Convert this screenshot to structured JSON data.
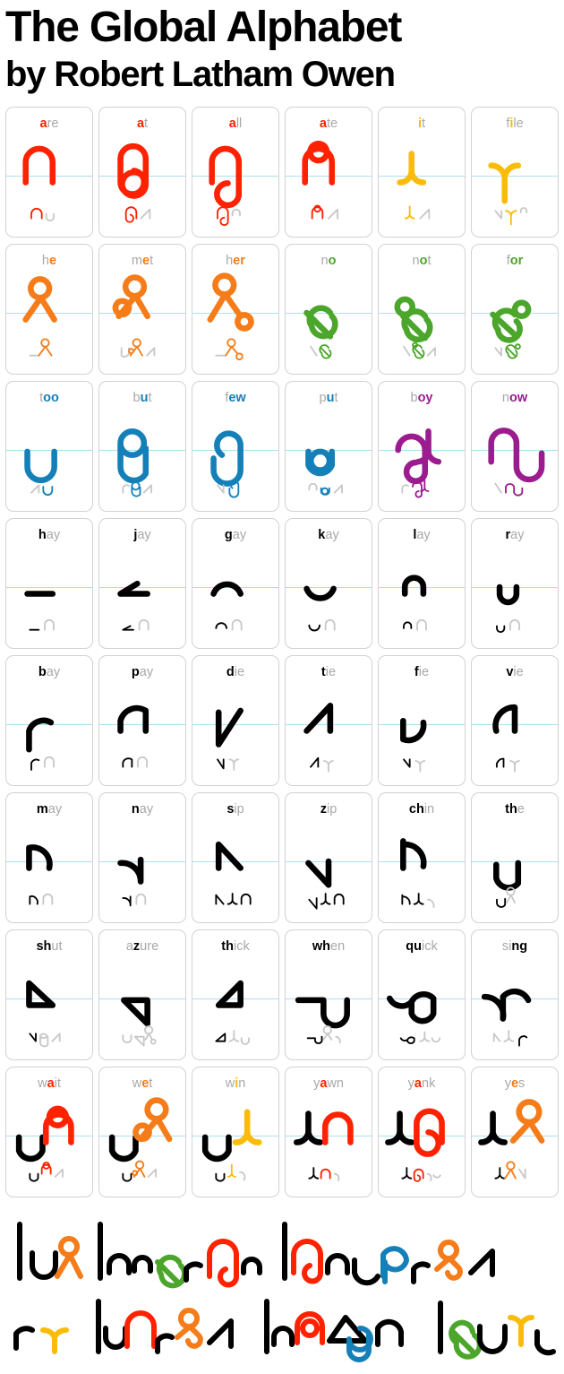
{
  "title": {
    "line1": "The Global Alphabet",
    "line2": "by Robert Latham Owen"
  },
  "colors": {
    "red": "#FF2200",
    "orange": "#F57C18",
    "amber": "#FABB0A",
    "green": "#4CA62B",
    "blue": "#1580B8",
    "purple": "#9B1C8E",
    "black": "#000000",
    "gray": "#a8a8a8",
    "light_gray": "#c8c8c8",
    "baseline": "#addff0",
    "card_border": "#d2d2d2"
  },
  "grid": {
    "columns": 6,
    "rows": 8,
    "cards": [
      {
        "word": "are",
        "highlight": "a",
        "color": "red",
        "big": "are",
        "small": "are"
      },
      {
        "word": "at",
        "highlight": "a",
        "color": "red",
        "big": "at",
        "small": "at"
      },
      {
        "word": "all",
        "highlight": "a",
        "color": "red",
        "big": "all",
        "small": "all"
      },
      {
        "word": "ate",
        "highlight": "a",
        "color": "red",
        "big": "ate",
        "small": "ate"
      },
      {
        "word": "it",
        "highlight": "i",
        "color": "amber",
        "big": "it",
        "small": "it"
      },
      {
        "word": "file",
        "highlight": "i",
        "color": "amber",
        "big": "file",
        "small": "file"
      },
      {
        "word": "he",
        "highlight": "e",
        "color": "orange",
        "big": "he",
        "small": "he"
      },
      {
        "word": "met",
        "highlight": "e",
        "color": "orange",
        "big": "met",
        "small": "met"
      },
      {
        "word": "her",
        "highlight": "er",
        "color": "orange",
        "big": "her",
        "small": "her"
      },
      {
        "word": "no",
        "highlight": "o",
        "color": "green",
        "big": "no",
        "small": "no"
      },
      {
        "word": "not",
        "highlight": "o",
        "color": "green",
        "big": "not",
        "small": "not"
      },
      {
        "word": "for",
        "highlight": "or",
        "color": "green",
        "big": "for",
        "small": "for"
      },
      {
        "word": "too",
        "highlight": "oo",
        "color": "blue",
        "big": "too",
        "small": "too"
      },
      {
        "word": "but",
        "highlight": "u",
        "color": "blue",
        "big": "but",
        "small": "but"
      },
      {
        "word": "few",
        "highlight": "ew",
        "color": "blue",
        "big": "few",
        "small": "few"
      },
      {
        "word": "put",
        "highlight": "u",
        "color": "blue",
        "big": "put",
        "small": "put"
      },
      {
        "word": "boy",
        "highlight": "oy",
        "color": "purple",
        "big": "boy",
        "small": "boy"
      },
      {
        "word": "now",
        "highlight": "ow",
        "color": "purple",
        "big": "now",
        "small": "now"
      },
      {
        "word": "hay",
        "highlight": "h",
        "color": "black",
        "big": "hay",
        "small": "hay"
      },
      {
        "word": "jay",
        "highlight": "j",
        "color": "black",
        "big": "jay",
        "small": "jay"
      },
      {
        "word": "gay",
        "highlight": "g",
        "color": "black",
        "big": "gay",
        "small": "gay"
      },
      {
        "word": "kay",
        "highlight": "k",
        "color": "black",
        "big": "kay",
        "small": "kay"
      },
      {
        "word": "lay",
        "highlight": "l",
        "color": "black",
        "big": "lay",
        "small": "lay"
      },
      {
        "word": "ray",
        "highlight": "r",
        "color": "black",
        "big": "ray",
        "small": "ray"
      },
      {
        "word": "bay",
        "highlight": "b",
        "color": "black",
        "big": "bay",
        "small": "bay"
      },
      {
        "word": "pay",
        "highlight": "p",
        "color": "black",
        "big": "pay",
        "small": "pay"
      },
      {
        "word": "die",
        "highlight": "d",
        "color": "black",
        "big": "die",
        "small": "die"
      },
      {
        "word": "tie",
        "highlight": "t",
        "color": "black",
        "big": "tie",
        "small": "tie"
      },
      {
        "word": "fie",
        "highlight": "f",
        "color": "black",
        "big": "fie",
        "small": "fie"
      },
      {
        "word": "vie",
        "highlight": "v",
        "color": "black",
        "big": "vie",
        "small": "vie"
      },
      {
        "word": "may",
        "highlight": "m",
        "color": "black",
        "big": "may",
        "small": "may"
      },
      {
        "word": "nay",
        "highlight": "n",
        "color": "black",
        "big": "nay",
        "small": "nay"
      },
      {
        "word": "sip",
        "highlight": "s",
        "color": "black",
        "big": "sip",
        "small": "sip"
      },
      {
        "word": "zip",
        "highlight": "z",
        "color": "black",
        "big": "zip",
        "small": "zip"
      },
      {
        "word": "chin",
        "highlight": "ch",
        "color": "black",
        "big": "chin",
        "small": "chin"
      },
      {
        "word": "the",
        "highlight": "th",
        "color": "black",
        "big": "the",
        "small": "the"
      },
      {
        "word": "shut",
        "highlight": "sh",
        "color": "black",
        "big": "shut",
        "small": "shut"
      },
      {
        "word": "azure",
        "highlight": "z",
        "color": "black",
        "big": "azure",
        "small": "azure"
      },
      {
        "word": "thick",
        "highlight": "th",
        "color": "black",
        "big": "thick",
        "small": "thick"
      },
      {
        "word": "when",
        "highlight": "wh",
        "color": "black",
        "big": "when",
        "small": "when"
      },
      {
        "word": "quick",
        "highlight": "qu",
        "color": "black",
        "big": "quick",
        "small": "quick"
      },
      {
        "word": "sing",
        "highlight": "ng",
        "color": "black",
        "big": "sing",
        "small": "sing"
      },
      {
        "word": "wait",
        "highlight": "a",
        "color": "red",
        "big": "wait",
        "small": "wait"
      },
      {
        "word": "wet",
        "highlight": "e",
        "color": "orange",
        "big": "wet",
        "small": "wet"
      },
      {
        "word": "win",
        "highlight": "i",
        "color": "amber",
        "big": "win",
        "small": "win"
      },
      {
        "word": "yawn",
        "highlight": "a",
        "color": "red",
        "big": "yawn",
        "small": "yawn"
      },
      {
        "word": "yank",
        "highlight": "a",
        "color": "red",
        "big": "yank",
        "small": "yank"
      },
      {
        "word": "yes",
        "highlight": "e",
        "color": "orange",
        "big": "yes",
        "small": "yes"
      }
    ]
  },
  "sample_text": {
    "description": "Two lines of sample writing in the Global Alphabet script",
    "line_count": 2,
    "line1_words": 3,
    "line2_words": 4
  }
}
